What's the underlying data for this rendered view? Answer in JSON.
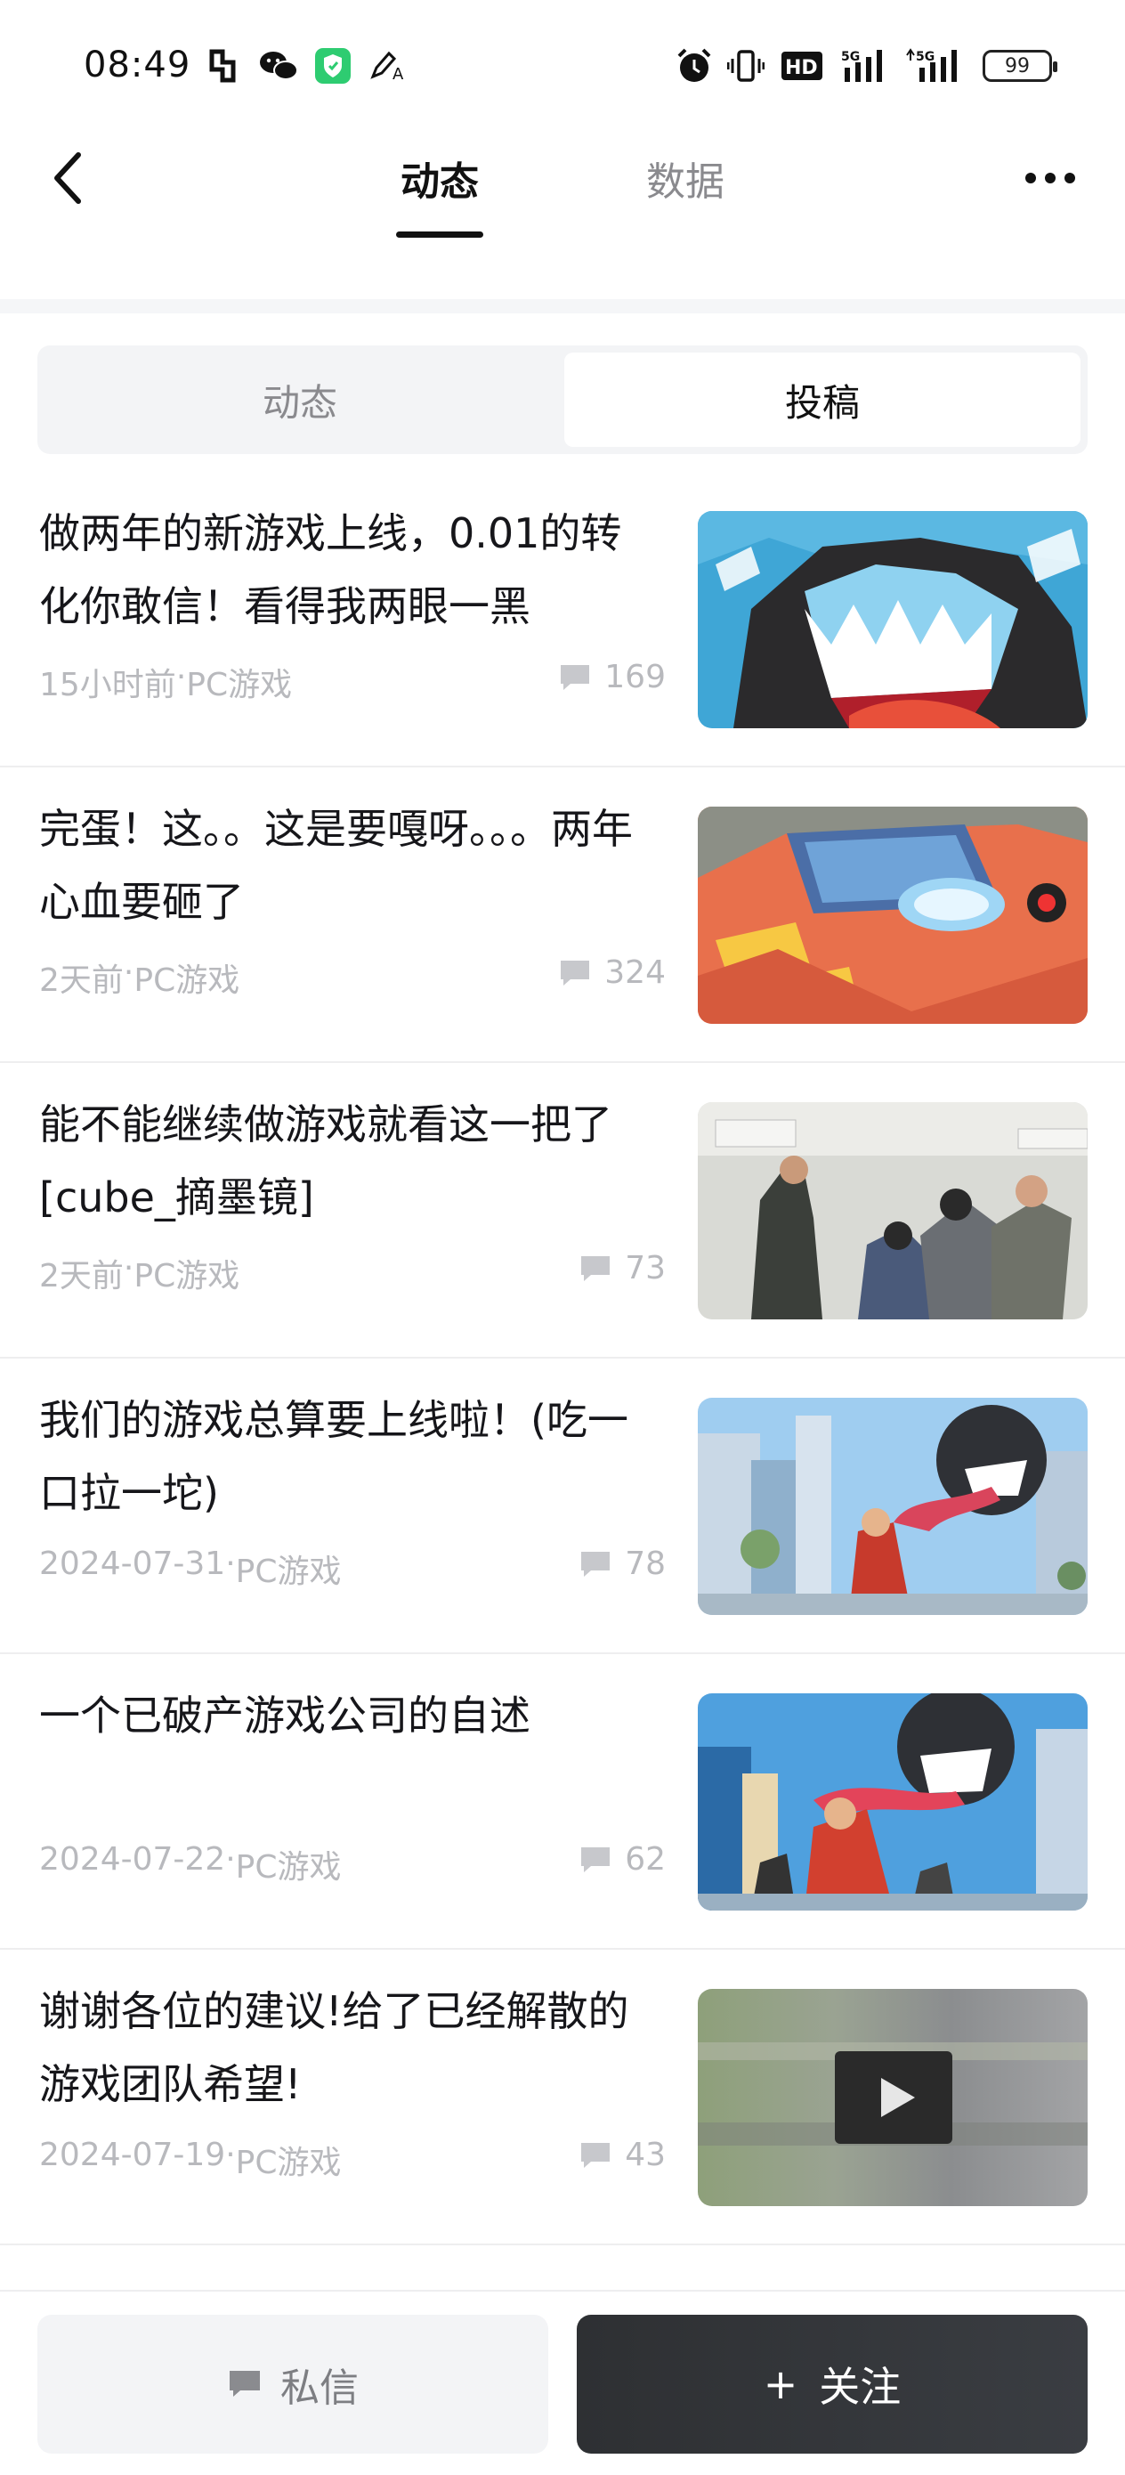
{
  "status_bar": {
    "time": "08:49",
    "network_1": "5G",
    "network_2": "5G",
    "hd_label": "HD",
    "battery": "99",
    "icons": [
      "app-icon",
      "wechat-icon",
      "shield-icon",
      "pen-icon",
      "alarm-icon",
      "vibrate-icon",
      "signal-icon",
      "signal-icon",
      "battery-icon"
    ]
  },
  "nav": {
    "tabs": [
      {
        "label": "动态",
        "active": true
      },
      {
        "label": "数据",
        "active": false
      }
    ]
  },
  "segment": {
    "items": [
      {
        "label": "动态",
        "selected": false
      },
      {
        "label": "投稿",
        "selected": true
      }
    ]
  },
  "posts": [
    {
      "title": "做两年的新游戏上线，0.01的转化你敢信！看得我两眼一黑",
      "time": "15小时前",
      "category": "PC游戏",
      "comments": "169",
      "thumb": "shark-monster"
    },
    {
      "title": "完蛋！这。。这是要嘎呀。。。两年心血要砸了",
      "time": "2天前",
      "category": "PC游戏",
      "comments": "324",
      "thumb": "game-board"
    },
    {
      "title": "能不能继续做游戏就看这一把了[cube_摘墨镜]",
      "time": "2天前",
      "category": "PC游戏",
      "comments": "73",
      "thumb": "office-photo"
    },
    {
      "title": "我们的游戏总算要上线啦！(吃一口拉一坨)",
      "time": "2024-07-31",
      "category": "PC游戏",
      "comments": "78",
      "thumb": "city-monster"
    },
    {
      "title": "一个已破产游戏公司的自述",
      "time": "2024-07-22",
      "category": "PC游戏",
      "comments": "62",
      "thumb": "city-monster-2"
    },
    {
      "title": "谢谢各位的建议!给了已经解散的游戏团队希望!",
      "time": "2024-07-19",
      "category": "PC游戏",
      "comments": "43",
      "thumb": "video-blur"
    }
  ],
  "meta_separator": "·",
  "bottom": {
    "message_label": "私信",
    "follow_label": "关注",
    "follow_prefix": "+"
  }
}
